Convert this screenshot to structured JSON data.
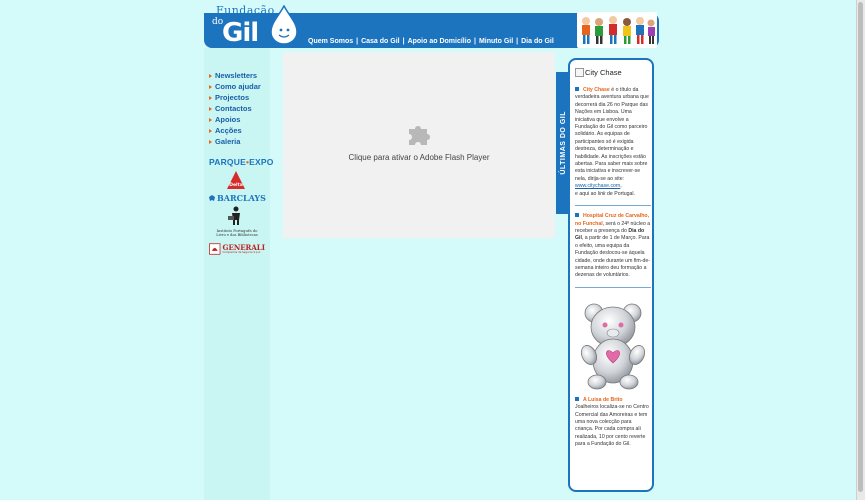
{
  "brand": {
    "logo_top": "Fundação",
    "logo_do": "do",
    "logo_gil": "Gil"
  },
  "nav": {
    "items": [
      "Quem Somos",
      "Casa do Gil",
      "Apoio ao Domicílio",
      "Minuto Gil",
      "Dia do Gil"
    ],
    "separator": "|"
  },
  "menu": {
    "items": [
      "Newsletters",
      "Como ajudar",
      "Projectos",
      "Contactos",
      "Apoios",
      "Acções",
      "Galeria"
    ]
  },
  "sponsors": {
    "parque_expo_a": "PARQUE",
    "parque_expo_b": "EXPO",
    "delta": "Delta",
    "barclays": "BARCLAYS",
    "ipltb_line1": "Instituto Português do",
    "ipltb_line2": "Livro e das Bibliotecas",
    "generali": "GENERALI",
    "generali_sub": "Companhia de Seguros S.p.A."
  },
  "flash": {
    "message": "Clique para ativar o Adobe Flash Player"
  },
  "news": {
    "tab_label": "ÚLTIMAS DO GIL",
    "image_alt": "City Chase",
    "items": [
      {
        "title": "City Chase",
        "body": " é o título da verdadeira aventura urbana que decorrerá dia 26 no Parque das Nações em Lisboa. Uma iniciativa que envolve a Fundação do Gil como parceiro solidário. As equipas de participantes só é exigida destreza, determinação e habilidade. As inscrições estão abertas. Para saber mais sobre esta iniciativa e inscrever-se nela, dirija-se ao site:",
        "link": "www.citychase.com",
        "tail_pre": "e aqui ao ",
        "tail_em": "link",
        "tail_post": " de Portugal."
      },
      {
        "title": "Hospital Cruz de Carvalho, no Funchal",
        "body_a": ", será o 24º núcleo a receber a presença do ",
        "bold": "Dia do Gil",
        "body_b": ", a partir de 1 de Março. Para o efeito, uma equipa da Fundação deslocou-se àquela cidade, onde durante um fim-de-semana inteiro deu formação a dezenas de voluntários."
      },
      {
        "title": "A Luisa de Brito",
        "body": "Joalheiros localiza-se no Centro Comercial das Amoreiras e tem uma nova colecção para criança. Por cada compra ali realizada, 10 por cento reverte para a Fundação do Gil."
      }
    ]
  },
  "colors": {
    "page_bg": "#d4fafa",
    "brand_blue": "#1c74bf",
    "accent_orange": "#e8641a"
  }
}
